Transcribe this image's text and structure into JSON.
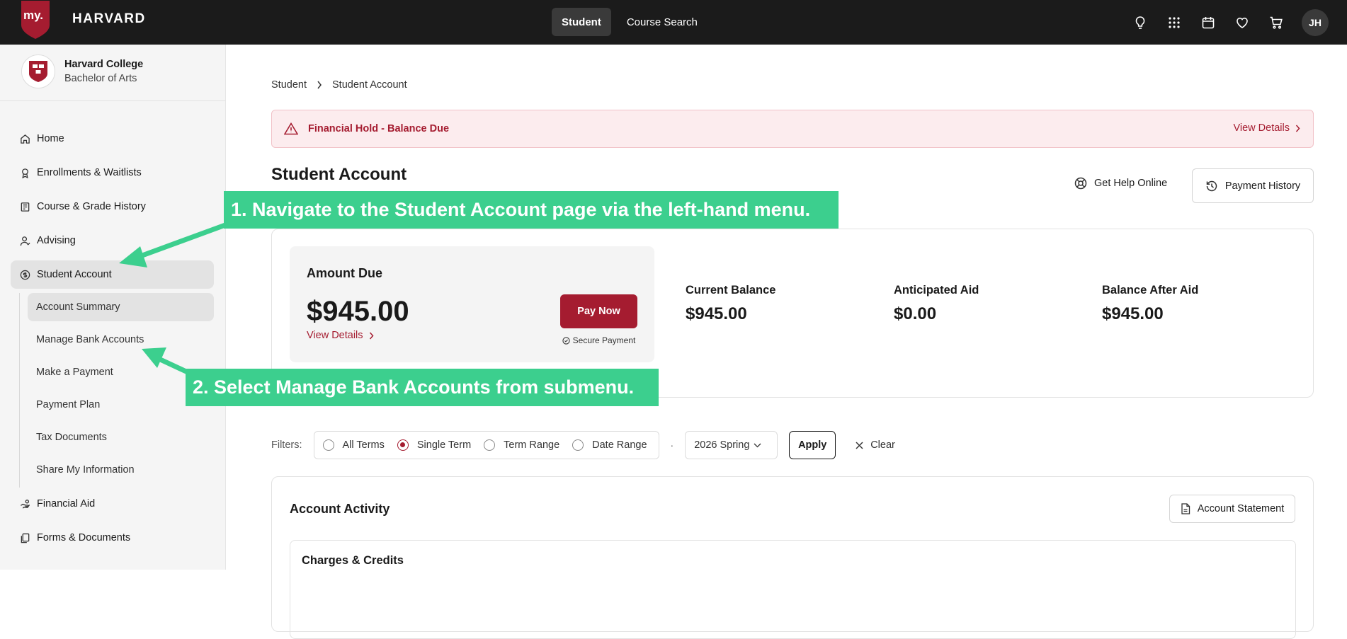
{
  "topbar": {
    "logo_prefix": "my.",
    "logo_name": "HARVARD",
    "nav": [
      {
        "label": "Student"
      },
      {
        "label": "Course Search"
      }
    ],
    "avatar_initials": "JH"
  },
  "sidebar": {
    "school_name": "Harvard College",
    "school_degree": "Bachelor of Arts",
    "items": [
      {
        "label": "Home",
        "icon": "home-icon"
      },
      {
        "label": "Enrollments & Waitlists",
        "icon": "ribbon-icon"
      },
      {
        "label": "Course & Grade History",
        "icon": "book-icon"
      },
      {
        "label": "Advising",
        "icon": "person-icon"
      },
      {
        "label": "Student Account",
        "icon": "dollar-circle-icon"
      },
      {
        "label": "Financial Aid",
        "icon": "hand-icon"
      },
      {
        "label": "Forms & Documents",
        "icon": "documents-icon"
      }
    ],
    "subitems": [
      {
        "label": "Account Summary"
      },
      {
        "label": "Manage Bank Accounts"
      },
      {
        "label": "Make a Payment"
      },
      {
        "label": "Payment Plan"
      },
      {
        "label": "Tax Documents"
      },
      {
        "label": "Share My Information"
      }
    ]
  },
  "breadcrumb": {
    "root": "Student",
    "current": "Student Account"
  },
  "alert": {
    "text": "Financial Hold - Balance Due",
    "link": "View Details"
  },
  "page": {
    "title": "Student Account",
    "help_label": "Get Help Online",
    "history_label": "Payment History"
  },
  "summary": {
    "due_label": "Amount Due",
    "due_amount": "$945.00",
    "due_link": "View Details",
    "pay_label": "Pay Now",
    "secure_label": "Secure Payment",
    "stats": [
      {
        "label": "Current Balance",
        "value": "$945.00"
      },
      {
        "label": "Anticipated Aid",
        "value": "$0.00"
      },
      {
        "label": "Balance After Aid",
        "value": "$945.00"
      }
    ]
  },
  "filters": {
    "label": "Filters:",
    "options": [
      {
        "label": "All Terms"
      },
      {
        "label": "Single Term"
      },
      {
        "label": "Term Range"
      },
      {
        "label": "Date Range"
      }
    ],
    "selected_index": 1,
    "separator": "·",
    "term": "2026 Spring",
    "apply_label": "Apply",
    "clear_label": "Clear"
  },
  "activity": {
    "title": "Account Activity",
    "statement_label": "Account Statement",
    "section_title": "Charges & Credits"
  },
  "annotations": {
    "step1": "1. Navigate to the Student Account page via the left-hand menu.",
    "step2": "2. Select Manage Bank Accounts from submenu."
  },
  "colors": {
    "brand": "#a51c30",
    "callout": "#3ccf8e",
    "topbar": "#1b1b1b"
  }
}
